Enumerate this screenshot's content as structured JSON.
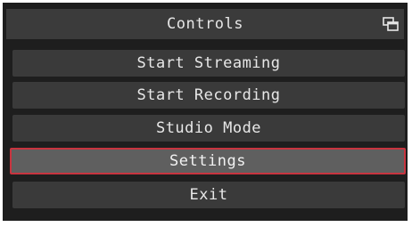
{
  "dock": {
    "title": "Controls",
    "undock_icon": "undock-icon"
  },
  "buttons": [
    {
      "label": "Start Streaming",
      "active": false
    },
    {
      "label": "Start Recording",
      "active": false
    },
    {
      "label": "Studio Mode",
      "active": false
    },
    {
      "label": "Settings",
      "active": true
    },
    {
      "label": "Exit",
      "active": false
    }
  ],
  "colors": {
    "panel_bg": "#1e1e1e",
    "header_bg": "#3b3b3b",
    "button_bg": "#3a3a3a",
    "active_bg": "#5f5f5f",
    "active_border": "#c8343f",
    "text": "#e8e8e8"
  }
}
